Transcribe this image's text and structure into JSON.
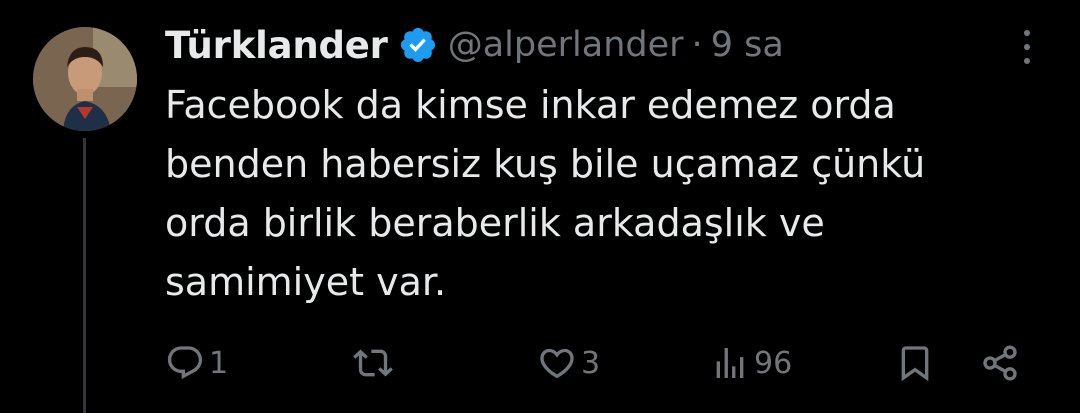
{
  "tweet": {
    "display_name": "Türklander",
    "handle": "@alperlander",
    "separator": "·",
    "time": "9 sa",
    "text": "Facebook da kimse inkar edemez orda\nbenden habersiz kuş bile uçamaz çünkü\norda birlik beraberlik arkadaşlık ve\nsamimiyet var.",
    "verified": true,
    "avatar_icon": "profile-photo"
  },
  "actions": {
    "reply": {
      "icon": "reply-icon",
      "count": "1"
    },
    "retweet": {
      "icon": "retweet-icon",
      "count": ""
    },
    "like": {
      "icon": "heart-icon",
      "count": "3"
    },
    "views": {
      "icon": "views-icon",
      "count": "96"
    },
    "bookmark": {
      "icon": "bookmark-icon"
    },
    "share": {
      "icon": "share-icon"
    }
  },
  "colors": {
    "background": "#000000",
    "text": "#e7e9ea",
    "muted": "#71767b",
    "verified": "#1d9bf0",
    "thread_line": "#333639"
  }
}
